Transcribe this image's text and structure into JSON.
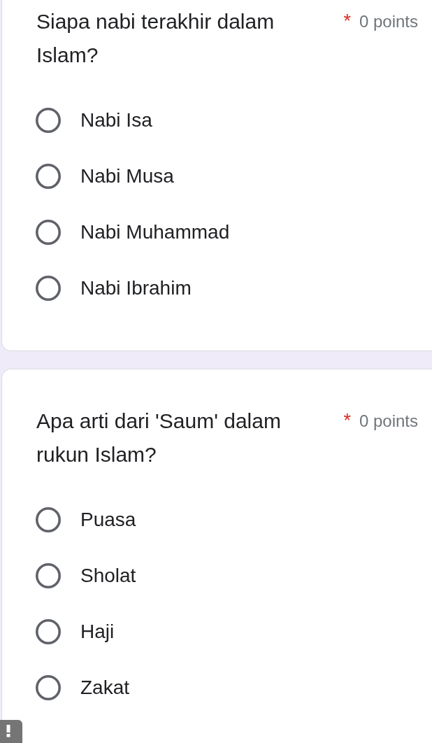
{
  "questions": [
    {
      "title": "Siapa nabi terakhir dalam Islam?",
      "required_mark": "*",
      "points": "0 points",
      "options": [
        {
          "label": "Nabi Isa",
          "selected": false
        },
        {
          "label": "Nabi Musa",
          "selected": false
        },
        {
          "label": "Nabi Muhammad",
          "selected": false
        },
        {
          "label": "Nabi Ibrahim",
          "selected": false
        }
      ]
    },
    {
      "title": "Apa arti dari 'Saum' dalam rukun Islam?",
      "required_mark": "*",
      "points": "0 points",
      "options": [
        {
          "label": "Puasa",
          "selected": false
        },
        {
          "label": "Sholat",
          "selected": false
        },
        {
          "label": "Haji",
          "selected": false
        },
        {
          "label": "Zakat",
          "selected": false
        }
      ]
    }
  ]
}
